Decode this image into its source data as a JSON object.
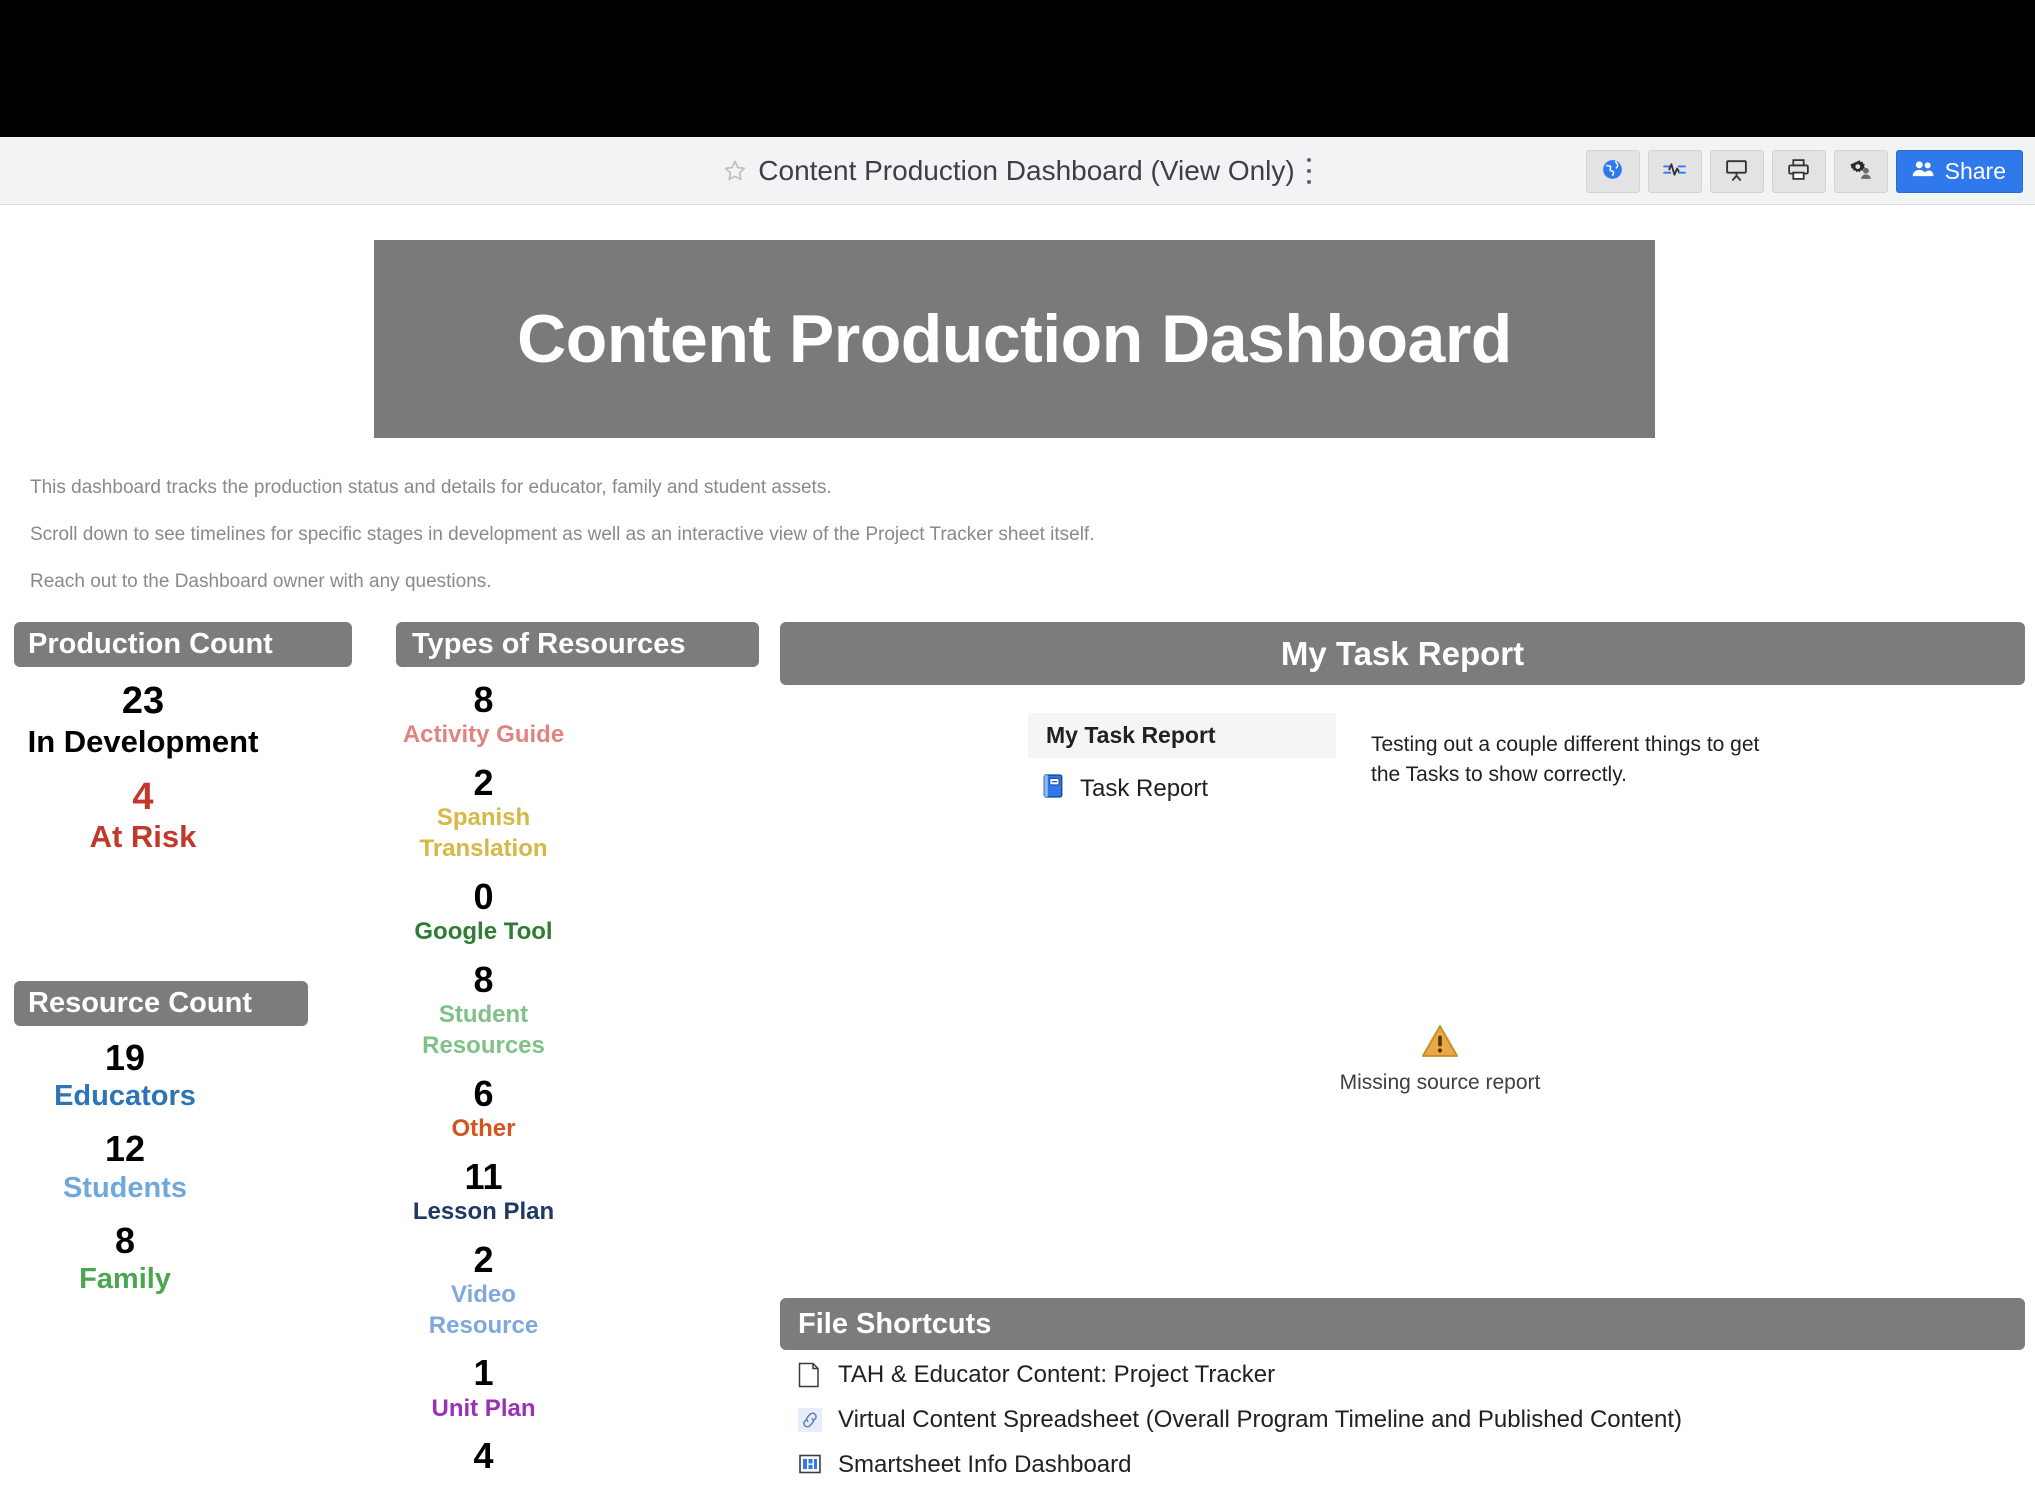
{
  "window": {
    "doc_title": "Content Production Dashboard (View Only)",
    "star_icon": "star-outline-icon",
    "kebab_icon": "more-options-icon",
    "toolbar": [
      {
        "name": "publish-globe-icon",
        "label": "Publish"
      },
      {
        "name": "activity-log-icon",
        "label": "Activity Log"
      },
      {
        "name": "presentation-icon",
        "label": "Presentation Mode"
      },
      {
        "name": "print-icon",
        "label": "Print"
      },
      {
        "name": "admin-settings-icon",
        "label": "Settings"
      }
    ],
    "share_label": "Share",
    "share_icon": "people-icon",
    "share_color": "#3079ed"
  },
  "banner": {
    "title": "Content Production Dashboard",
    "background": "#7a7a7a",
    "text_color": "#ffffff"
  },
  "intro": {
    "lines": [
      "This dashboard tracks the production status and details for educator, family and student assets.",
      "Scroll down to see timelines for specific stages in development as well as an interactive view of the Project Tracker sheet itself.",
      "Reach out to the Dashboard owner with any questions."
    ],
    "color": "#8a8a8a"
  },
  "production_count": {
    "header": "Production Count",
    "items": [
      {
        "value": "23",
        "label": "In Development",
        "color": "#000000"
      },
      {
        "value": "4",
        "label": "At Risk",
        "color": "#c0392b"
      }
    ]
  },
  "resource_count": {
    "header": "Resource Count",
    "items": [
      {
        "value": "19",
        "label": "Educators",
        "color": "#2e75b6"
      },
      {
        "value": "12",
        "label": "Students",
        "color": "#6fa8dc"
      },
      {
        "value": "8",
        "label": "Family",
        "color": "#4aa750"
      }
    ]
  },
  "types_of_resources": {
    "header": "Types of Resources",
    "items": [
      {
        "value": "8",
        "label": "Activity Guide",
        "color": "#e08480"
      },
      {
        "value": "2",
        "label": "Spanish Translation",
        "color": "#d5b845"
      },
      {
        "value": "0",
        "label": "Google Tool",
        "color": "#2e7d32"
      },
      {
        "value": "8",
        "label": "Student Resources",
        "color": "#82c08a"
      },
      {
        "value": "6",
        "label": "Other",
        "color": "#d2551e"
      },
      {
        "value": "11",
        "label": "Lesson Plan",
        "color": "#1f3864"
      },
      {
        "value": "2",
        "label": "Video Resource",
        "color": "#7fa8dc"
      },
      {
        "value": "1",
        "label": "Unit Plan",
        "color": "#9b30b8"
      },
      {
        "value": "4",
        "label": "",
        "color": "#000000"
      }
    ]
  },
  "task_report": {
    "header": "My Task Report",
    "card_title": "My Task Report",
    "row_label": "Task Report",
    "row_icon": "report-sheet-icon",
    "description": "Testing out a couple different things to get the Tasks to show correctly.",
    "warning_icon": "warning-triangle-icon",
    "warning_text": "Missing source report",
    "warning_color": "#eda844"
  },
  "file_shortcuts": {
    "header": "File Shortcuts",
    "items": [
      {
        "icon": "sheet-icon",
        "label": "TAH & Educator Content: Project Tracker"
      },
      {
        "icon": "link-icon",
        "label": "Virtual Content Spreadsheet (Overall Program Timeline and Published Content)"
      },
      {
        "icon": "dashboard-icon",
        "label": "Smartsheet Info Dashboard"
      }
    ]
  }
}
